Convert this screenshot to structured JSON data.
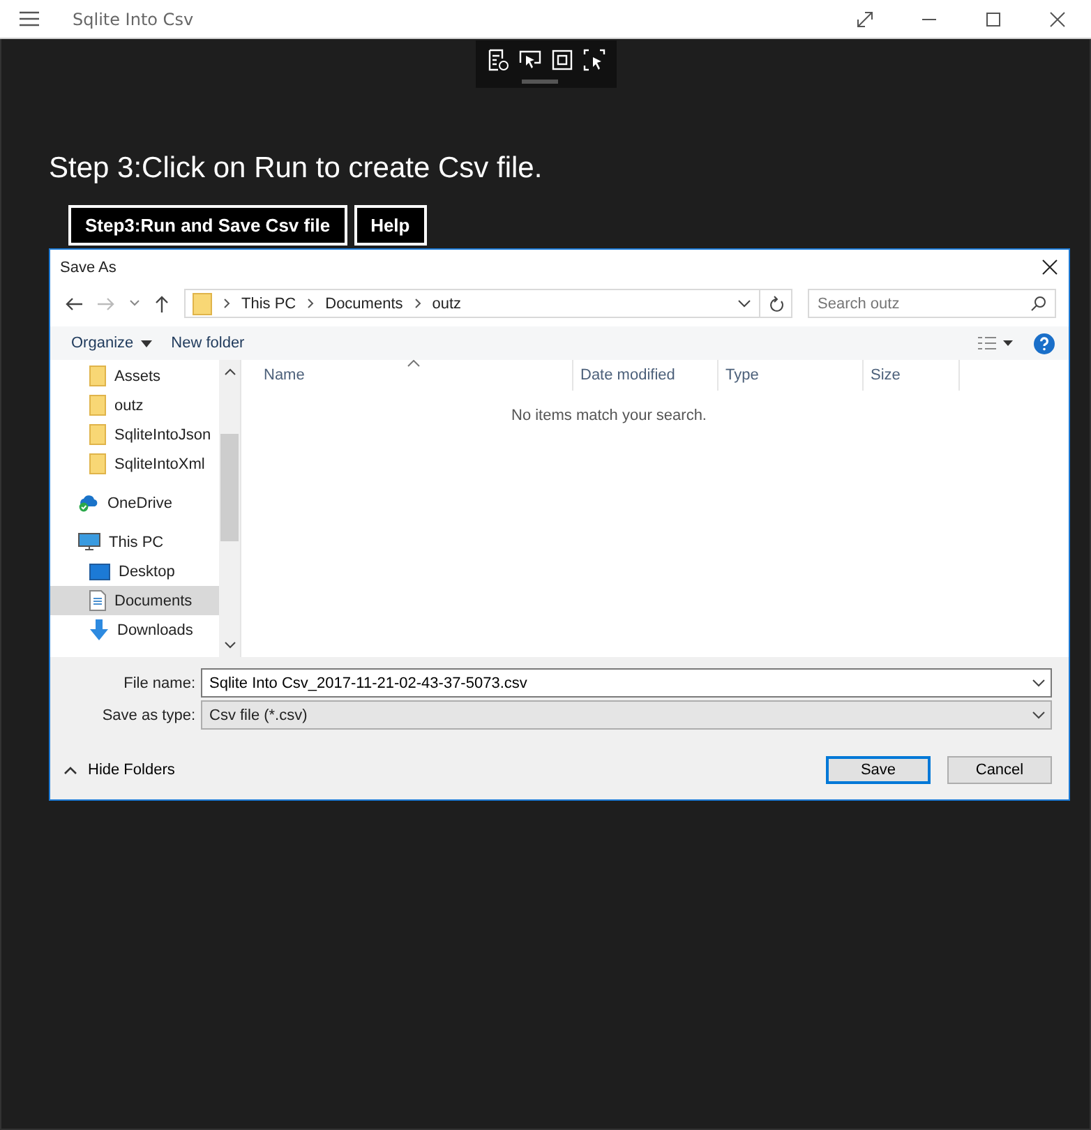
{
  "window": {
    "title": "Sqlite Into Csv"
  },
  "heading": "Step 3:Click on Run to create Csv file.",
  "buttons": [
    {
      "label": "Step3:Run and Save Csv file"
    },
    {
      "label": "Help"
    }
  ],
  "dialog": {
    "title": "Save As",
    "breadcrumb": [
      "This PC",
      "Documents",
      "outz"
    ],
    "search": {
      "placeholder": "Search outz"
    },
    "commands": {
      "organize": "Organize",
      "new_folder": "New folder"
    },
    "nav": [
      {
        "label": "Assets",
        "kind": "folder",
        "selected": false
      },
      {
        "label": "outz",
        "kind": "folder",
        "selected": false
      },
      {
        "label": "SqliteIntoJson",
        "kind": "folder",
        "selected": false
      },
      {
        "label": "SqliteIntoXml",
        "kind": "folder",
        "selected": false
      },
      {
        "label": "OneDrive",
        "kind": "cloud",
        "selected": false
      },
      {
        "label": "This PC",
        "kind": "pc",
        "selected": false
      },
      {
        "label": "Desktop",
        "kind": "desktop",
        "selected": false
      },
      {
        "label": "Documents",
        "kind": "document",
        "selected": true
      },
      {
        "label": "Downloads",
        "kind": "download",
        "selected": false
      }
    ],
    "columns": [
      "Name",
      "Date modified",
      "Type",
      "Size"
    ],
    "empty_message": "No items match your search.",
    "file_name": {
      "label": "File name:",
      "value": "Sqlite Into Csv_2017-11-21-02-43-37-5073.csv"
    },
    "save_type": {
      "label": "Save as type:",
      "value": "Csv file (*.csv)"
    },
    "hide_folders": "Hide Folders",
    "actions": [
      {
        "label": "Save",
        "default": true
      },
      {
        "label": "Cancel",
        "default": false
      }
    ]
  }
}
